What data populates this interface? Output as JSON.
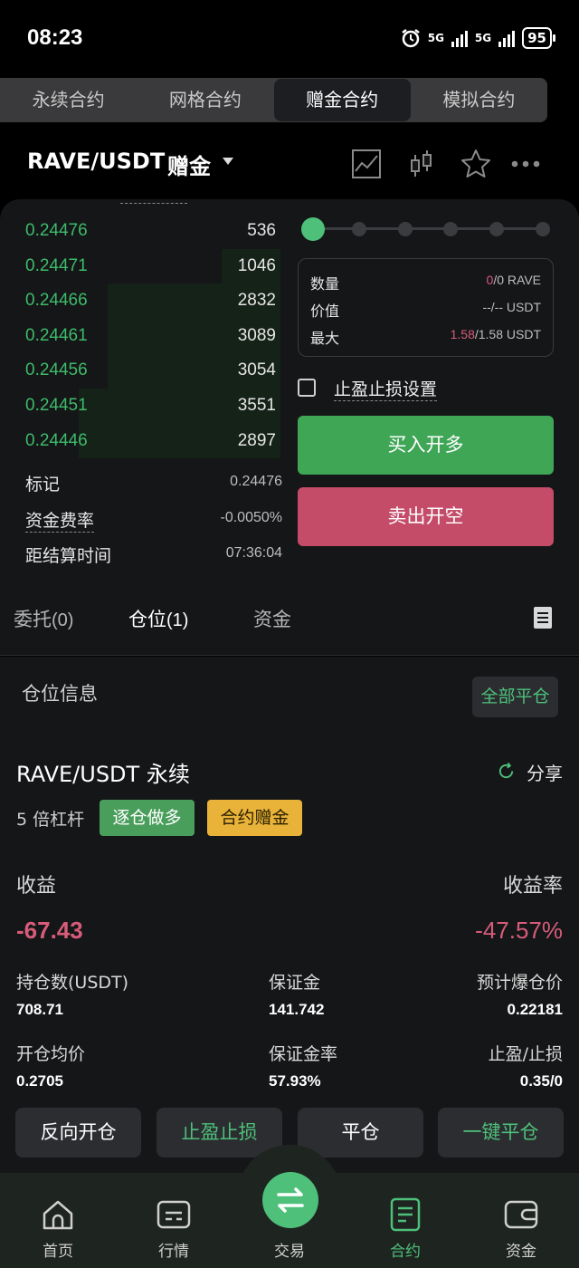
{
  "status_bar": {
    "time": "08:23",
    "net1": "5G",
    "net2": "5G",
    "battery": "95"
  },
  "mode_tabs": [
    "永续合约",
    "网格合约",
    "赠金合约",
    "模拟合约"
  ],
  "pair": {
    "name": "RAVE/USDT",
    "badge": "赠金"
  },
  "orderbook": {
    "rows": [
      {
        "price": "0.24476",
        "qty": "536",
        "depth": 0.0
      },
      {
        "price": "0.24471",
        "qty": "1046",
        "depth": 0.27
      },
      {
        "price": "0.24466",
        "qty": "2832",
        "depth": 0.79
      },
      {
        "price": "0.24461",
        "qty": "3089",
        "depth": 0.79
      },
      {
        "price": "0.24456",
        "qty": "3054",
        "depth": 0.79
      },
      {
        "price": "0.24451",
        "qty": "3551",
        "depth": 0.92
      },
      {
        "price": "0.24446",
        "qty": "2897",
        "depth": 0.92
      }
    ]
  },
  "market_info": {
    "mark_label": "标记",
    "mark_value": "0.24476",
    "funding_label": "资金费率",
    "funding_value": "-0.0050%",
    "settle_label": "距结算时间",
    "settle_value": "07:36:04"
  },
  "order_form": {
    "leverage_steps": 6,
    "leverage_selected": 0,
    "qty_label": "数量",
    "qty_value_a": "0",
    "qty_value_b": "/0 RAVE",
    "value_label": "价值",
    "value_value": "--/-- USDT",
    "max_label": "最大",
    "max_value_a": "1.58",
    "max_value_b": "/1.58 USDT",
    "tpsl_label": "止盈止损设置",
    "buy_label": "买入开多",
    "sell_label": "卖出开空"
  },
  "sub_tabs": {
    "orders": "委托",
    "orders_count": "(0)",
    "positions": "仓位",
    "positions_count": "(1)",
    "funds": "资金"
  },
  "position": {
    "section_title": "仓位信息",
    "close_all_label": "全部平仓",
    "name": "RAVE/USDT 永续",
    "share_label": "分享",
    "leverage": "5 倍杠杆",
    "tag_mode": "逐仓做多",
    "tag_bonus": "合约赠金",
    "pnl_label": "收益",
    "pnl_value": "-67.43",
    "roe_label": "收益率",
    "roe_value": "-47.57%",
    "size_label": "持仓数(USDT)",
    "size_value": "708.71",
    "margin_label": "保证金",
    "margin_value": "141.742",
    "liq_label": "预计爆仓价",
    "liq_value": "0.22181",
    "entry_label": "开仓均价",
    "entry_value": "0.2705",
    "margin_ratio_label": "保证金率",
    "margin_ratio_value": "57.93%",
    "tpsl_label": "止盈/止损",
    "tpsl_value": "0.35/0",
    "actions": [
      "反向开仓",
      "止盈止损",
      "平仓",
      "一键平仓"
    ]
  },
  "bottom_nav": [
    "首页",
    "行情",
    "交易",
    "合约",
    "资金"
  ],
  "colors": {
    "green": "#4ec07a",
    "red": "#d65c7a",
    "gold": "#e9b33a"
  }
}
